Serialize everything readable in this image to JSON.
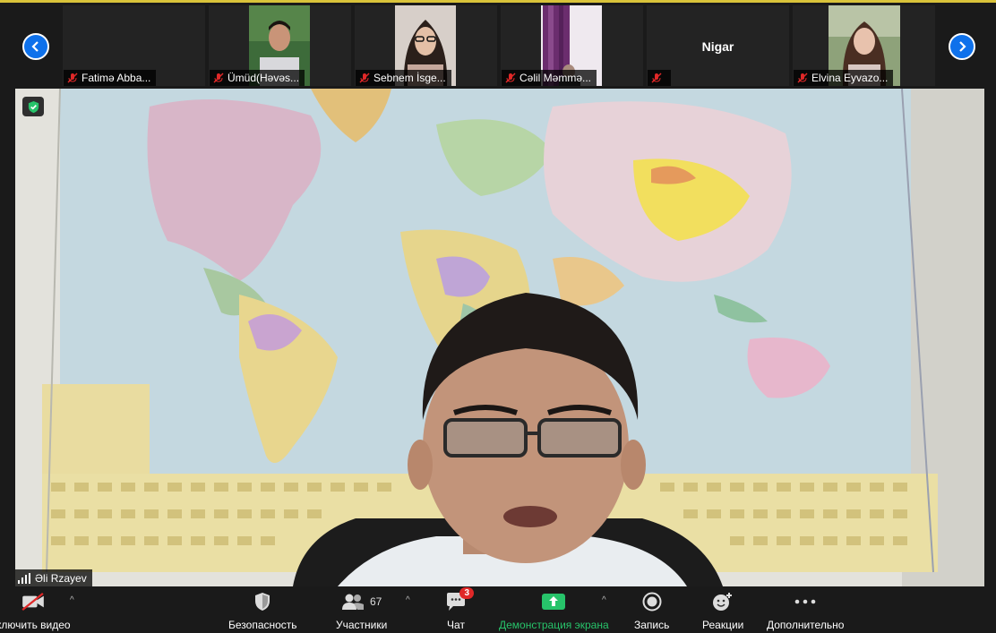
{
  "participants": [
    {
      "name": "Fatimə Abba..."
    },
    {
      "name": "Ümüd(Həvəs..."
    },
    {
      "name": "Sebnem İsge..."
    },
    {
      "name": "Cəlil Məmmə..."
    },
    {
      "name": "",
      "display_name": "Nigar"
    },
    {
      "name": "Elvina Eyvazo..."
    }
  ],
  "speaker": {
    "name": "Əli Rzayev"
  },
  "toolbar": {
    "video_label": "ключить видео",
    "security_label": "Безопасность",
    "participants_label": "Участники",
    "participants_count": "67",
    "chat_label": "Чат",
    "chat_badge": "3",
    "share_label": "Демонстрация экрана",
    "record_label": "Запись",
    "reactions_label": "Реакции",
    "more_label": "Дополнительно"
  },
  "colors": {
    "accent": "#0e71eb",
    "share_green": "#27c36a",
    "mute_red": "#e02828",
    "top_border": "#d9c33a"
  }
}
